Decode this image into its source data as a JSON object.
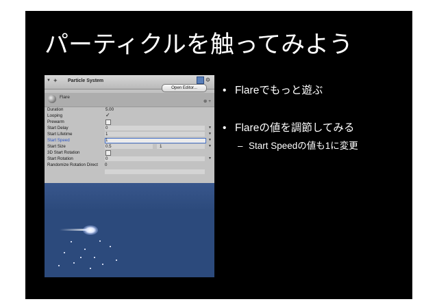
{
  "slide": {
    "title": "パーティクルを触ってみよう",
    "bullets": [
      {
        "text": "Flareでもっと遊ぶ"
      },
      {
        "text": "Flareの値を調節してみる",
        "sub": "Start Speedの値も1に変更"
      }
    ]
  },
  "inspector": {
    "component_title": "Particle System",
    "open_editor_label": "Open Editor...",
    "tab_label": "Flare",
    "properties": [
      {
        "label": "Duration",
        "value": "5.00"
      },
      {
        "label": "Looping",
        "value": "✓"
      },
      {
        "label": "Prewarm",
        "value": ""
      },
      {
        "label": "Start Delay",
        "value": "0"
      },
      {
        "label": "Start Lifetime",
        "value": "1"
      },
      {
        "label": "Start Speed",
        "value": "1"
      },
      {
        "label": "Start Size",
        "value": "0.5",
        "value2": "1"
      },
      {
        "label": "3D Start Rotation",
        "value": ""
      },
      {
        "label": "Start Rotation",
        "value": "0"
      },
      {
        "label": "Randomize Rotation Direct",
        "value": "0"
      }
    ]
  },
  "colors": {
    "slide_bg": "#000000",
    "text": "#ffffff",
    "inspector_bg": "#c2c2c2",
    "active_field": "#4470c8",
    "scene_bg": "#2c4a7c"
  }
}
